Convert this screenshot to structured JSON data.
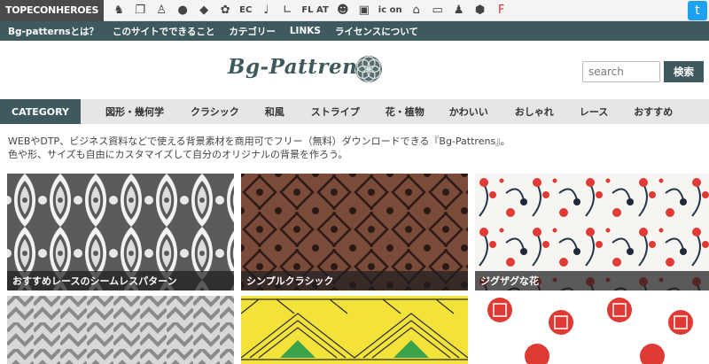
{
  "topbar": {
    "brand": "TOPECONHEROES",
    "icons": [
      "horse-icon",
      "copy-icon",
      "person-icon",
      "speech-icon",
      "paw-icon",
      "flower-icon"
    ],
    "ec": "EC",
    "icons2": [
      "music-note-icon",
      "line-icon"
    ],
    "flat": "FL AT",
    "icons3": [
      "face-icon",
      "p-icon"
    ],
    "icon_text": "ic on",
    "icons4": [
      "building-icon",
      "bed-icon",
      "person-box-icon",
      "hexagon-icon",
      "ff-icon"
    ]
  },
  "subnav": [
    "Bg-patternsとは？",
    "このサイトでできること",
    "カテゴリー",
    "LINKS",
    "ライセンスについて"
  ],
  "header": {
    "logo": "Bg-Pattrens",
    "search_placeholder": "search",
    "search_button": "検索"
  },
  "categories": {
    "head": "CATEGORY",
    "items": [
      "図形・幾何学",
      "クラシック",
      "和風",
      "ストライプ",
      "花・植物",
      "かわいい",
      "おしゃれ",
      "レース",
      "おすすめ"
    ]
  },
  "intro": {
    "line1": "WEBやDTP、ビジネス資料などで使える背景素材を商用可でフリー（無料）ダウンロードできる『Bg-Pattrens』。",
    "line2": "色や形、サイズも自由にカスタマイズして自分のオリジナルの背景を作ろう。"
  },
  "tiles": [
    {
      "caption": "おすすめレースのシームレスパターン"
    },
    {
      "caption": "シンプルクラシック"
    },
    {
      "caption": "ジグザグな花"
    },
    {
      "caption": ""
    },
    {
      "caption": ""
    },
    {
      "caption": ""
    }
  ],
  "colors": {
    "accent": "#3e5a5e",
    "classic_bg": "#7a4a3a",
    "yellow": "#f2e23a",
    "red": "#e03a34"
  }
}
